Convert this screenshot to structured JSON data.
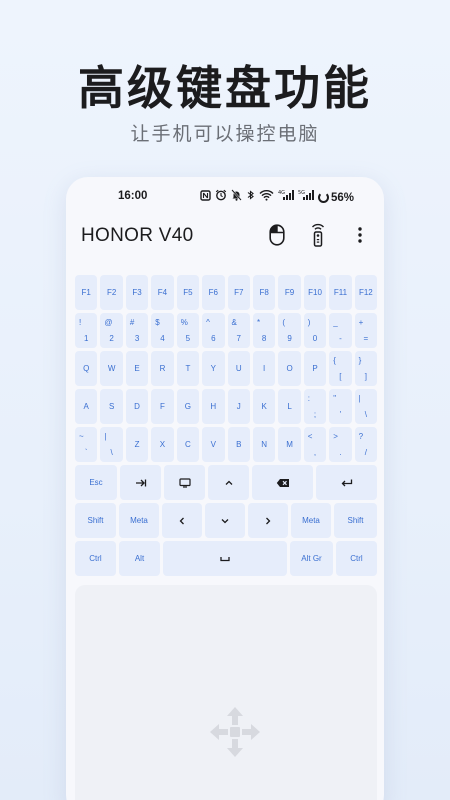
{
  "promo": {
    "title": "高级键盘功能",
    "subtitle": "让手机可以操控电脑"
  },
  "statusbar": {
    "time": "16:00",
    "battery": "56%",
    "icons": [
      "nfc-icon",
      "alarm-icon",
      "mute-icon",
      "bluetooth-icon",
      "wifi-icon",
      "signal-4g-icon",
      "signal-5g-icon"
    ]
  },
  "app": {
    "title": "HONOR V40",
    "actions": [
      "mouse-icon",
      "remote-icon",
      "more-icon"
    ]
  },
  "keyboard": {
    "f_row": [
      "F1",
      "F2",
      "F3",
      "F4",
      "F5",
      "F6",
      "F7",
      "F8",
      "F9",
      "F10",
      "F11",
      "F12"
    ],
    "num_row": [
      {
        "top": "!",
        "bot": "1"
      },
      {
        "top": "@",
        "bot": "2"
      },
      {
        "top": "#",
        "bot": "3"
      },
      {
        "top": "$",
        "bot": "4"
      },
      {
        "top": "%",
        "bot": "5"
      },
      {
        "top": "^",
        "bot": "6"
      },
      {
        "top": "&",
        "bot": "7"
      },
      {
        "top": "*",
        "bot": "8"
      },
      {
        "top": "(",
        "bot": "9"
      },
      {
        "top": ")",
        "bot": "0"
      },
      {
        "top": "_",
        "bot": "-"
      },
      {
        "top": "+",
        "bot": "="
      }
    ],
    "q_row": [
      {
        "bot": "Q"
      },
      {
        "bot": "W"
      },
      {
        "bot": "E"
      },
      {
        "bot": "R"
      },
      {
        "bot": "T"
      },
      {
        "bot": "Y"
      },
      {
        "bot": "U"
      },
      {
        "bot": "I"
      },
      {
        "bot": "O"
      },
      {
        "bot": "P"
      },
      {
        "top": "{",
        "bot": "["
      },
      {
        "top": "}",
        "bot": "]"
      }
    ],
    "a_row": [
      {
        "bot": "A"
      },
      {
        "bot": "S"
      },
      {
        "bot": "D"
      },
      {
        "bot": "F"
      },
      {
        "bot": "G"
      },
      {
        "bot": "H"
      },
      {
        "bot": "J"
      },
      {
        "bot": "K"
      },
      {
        "bot": "L"
      },
      {
        "top": ":",
        "bot": ";"
      },
      {
        "top": "\"",
        "bot": "'"
      },
      {
        "top": "|",
        "bot": "\\"
      }
    ],
    "z_row": [
      {
        "top": "~",
        "bot": "`"
      },
      {
        "top": "|",
        "bot": "\\"
      },
      {
        "bot": "Z"
      },
      {
        "bot": "X"
      },
      {
        "bot": "C"
      },
      {
        "bot": "V"
      },
      {
        "bot": "B"
      },
      {
        "bot": "N"
      },
      {
        "bot": "M"
      },
      {
        "top": "<",
        "bot": ","
      },
      {
        "top": ">",
        "bot": "."
      },
      {
        "top": "?",
        "bot": "/"
      }
    ],
    "ctrl_row1": {
      "esc": "Esc",
      "tab": "⇥",
      "screen": "⬚",
      "up": "^",
      "backspace": "⌫",
      "enter": "↵"
    },
    "ctrl_row2": {
      "shift_left": "Shift",
      "meta_left": "Meta",
      "left": "‹",
      "down": "⌄",
      "right": "›",
      "meta_right": "Meta",
      "shift_right": "Shift"
    },
    "ctrl_row3": {
      "ctrl_left": "Ctrl",
      "alt_left": "Alt",
      "space": "␣",
      "altgr": "Alt Gr",
      "ctrl_right": "Ctrl"
    }
  },
  "colors": {
    "key_bg": "#e6edfb",
    "key_text": "#3a6fd1",
    "title": "#1c1c1e"
  }
}
